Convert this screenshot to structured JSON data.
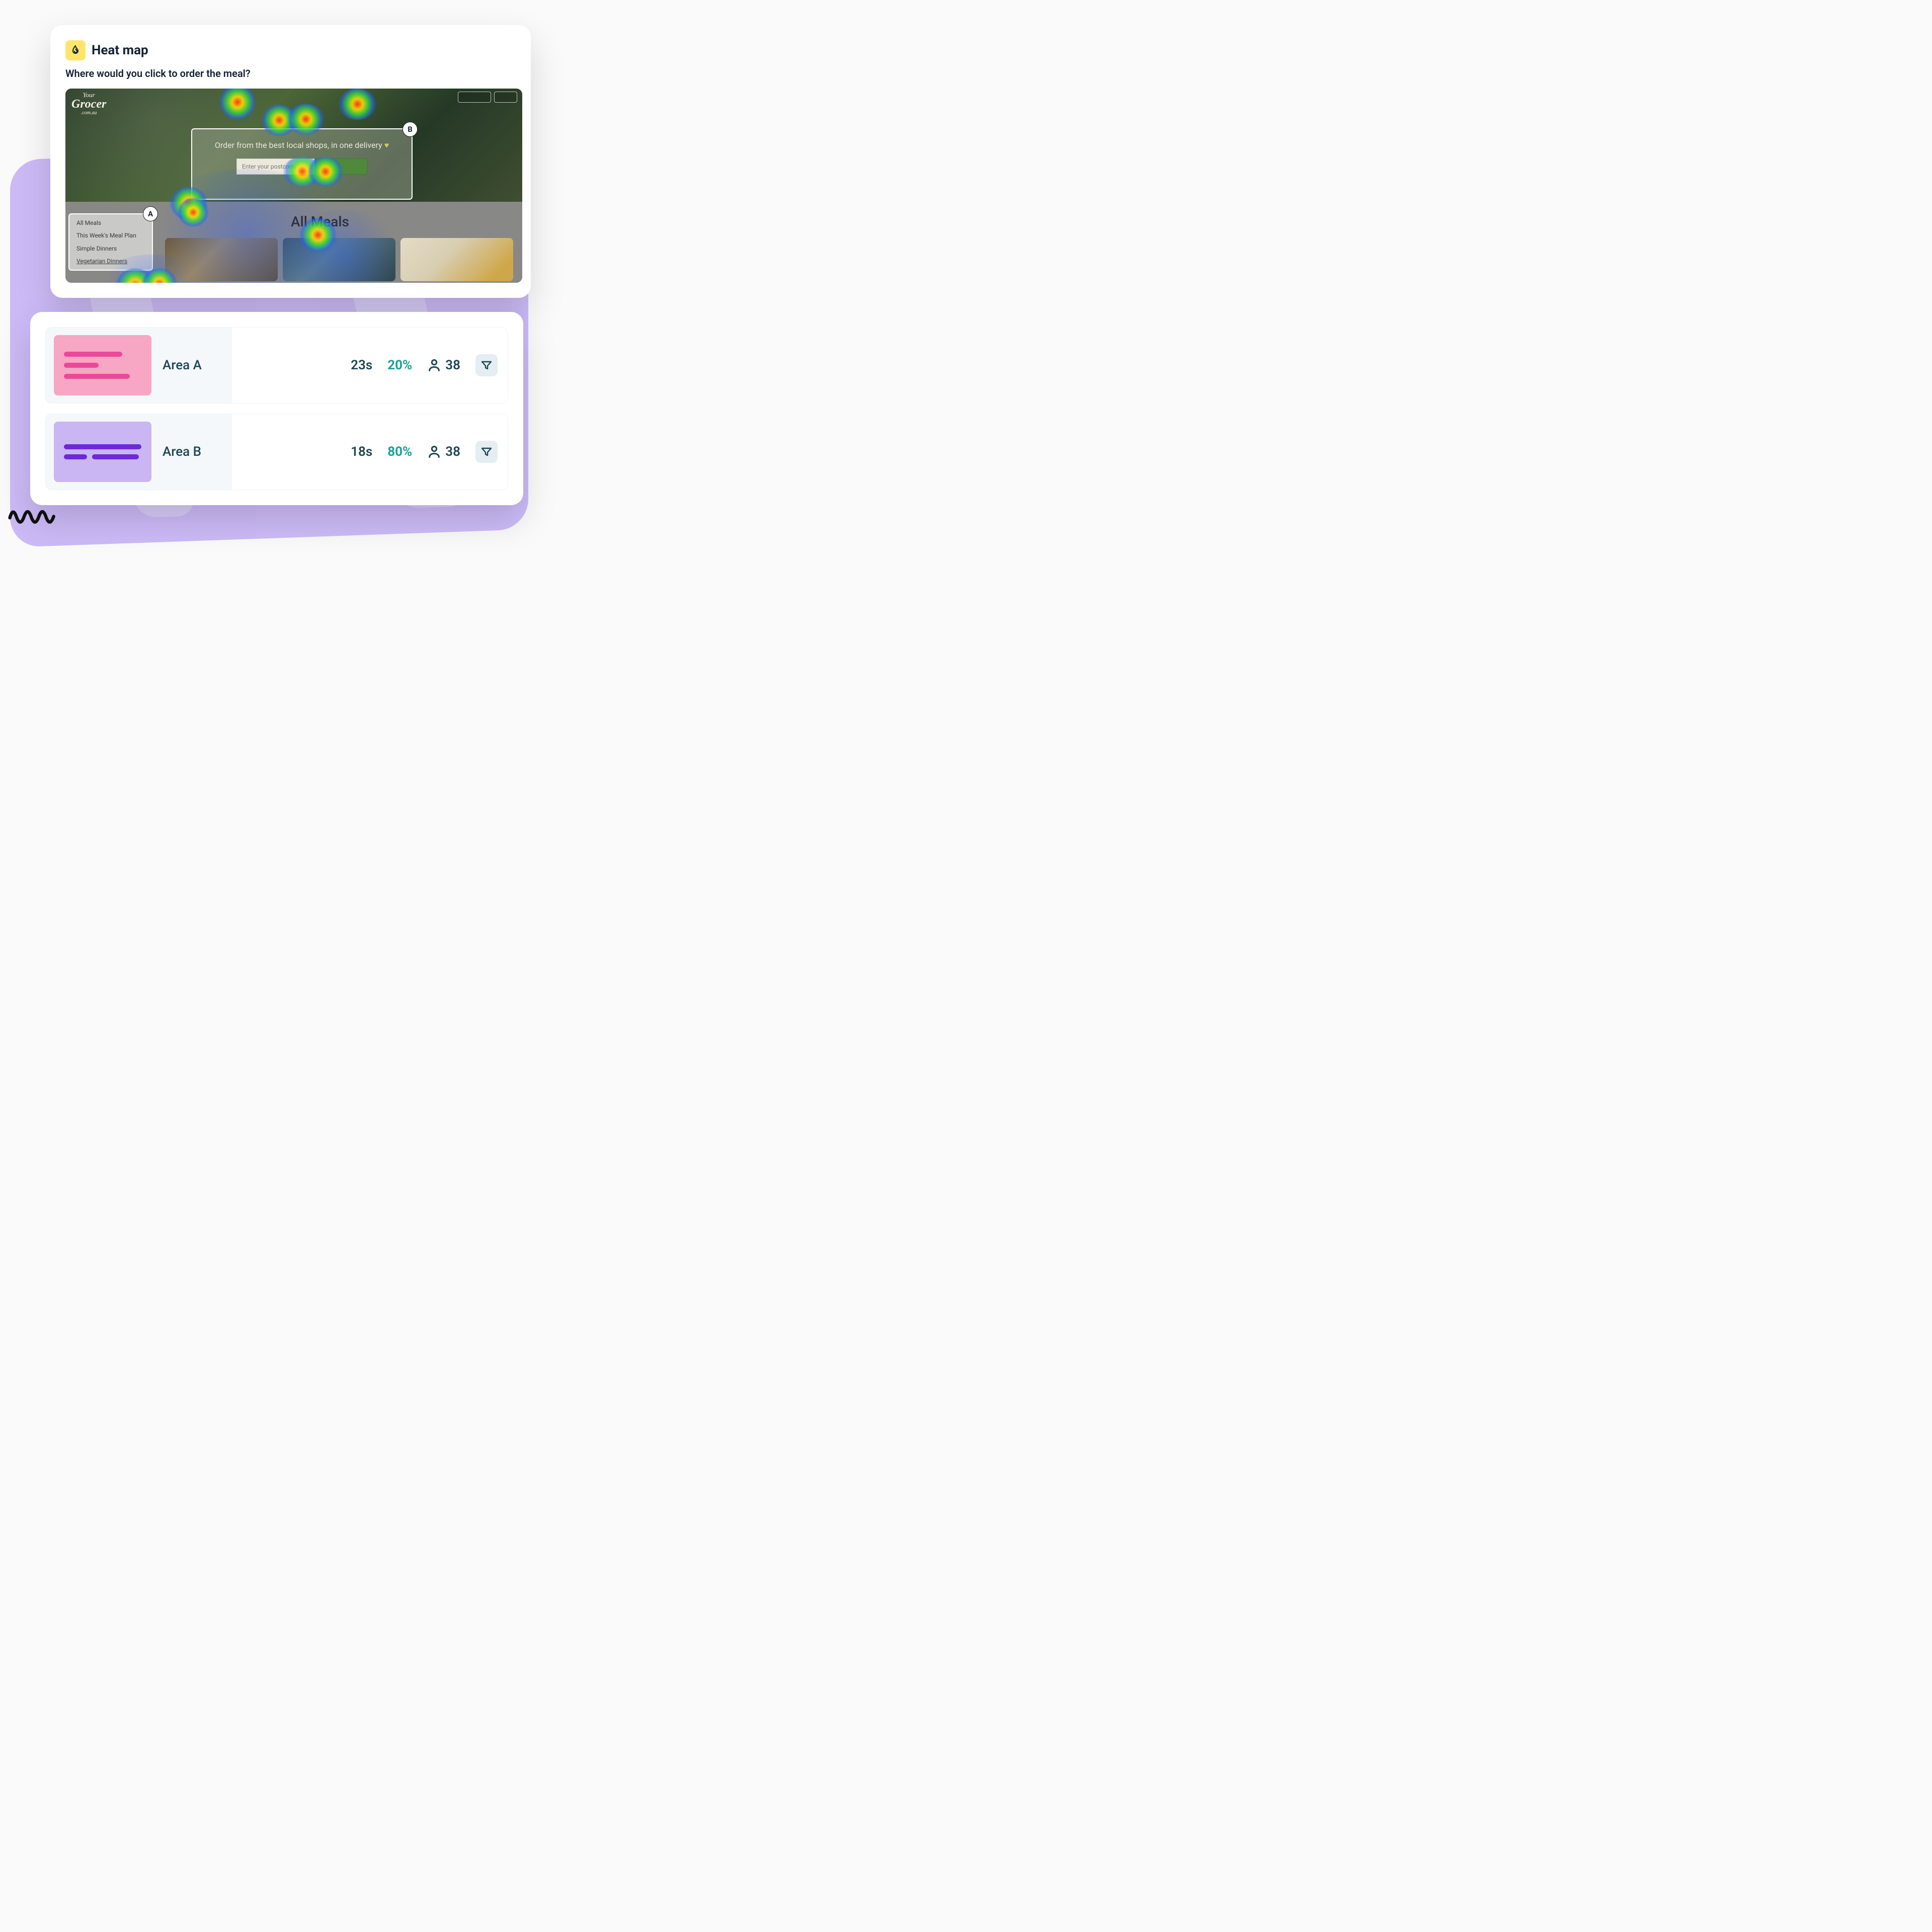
{
  "card": {
    "title": "Heat map",
    "subtitle": "Where would you click to order the meal?"
  },
  "heatmap": {
    "logo": {
      "l1": "Your",
      "l2": "Grocer",
      "l3": ".com.au"
    },
    "tagline": "Order from the best local shops, in one delivery",
    "postcode_placeholder": "Enter your postcode",
    "section_heading": "All Meals",
    "sidebar": {
      "item1": "All Meals",
      "item2": "This Week's Meal Plan",
      "item3": "Simple Dinners",
      "item4": "Vegetarian Dinners"
    },
    "badges": {
      "a": "A",
      "b": "B"
    }
  },
  "areas": [
    {
      "label": "Area A",
      "time": "23s",
      "percent": "20%",
      "people": "38"
    },
    {
      "label": "Area B",
      "time": "18s",
      "percent": "80%",
      "people": "38"
    }
  ]
}
